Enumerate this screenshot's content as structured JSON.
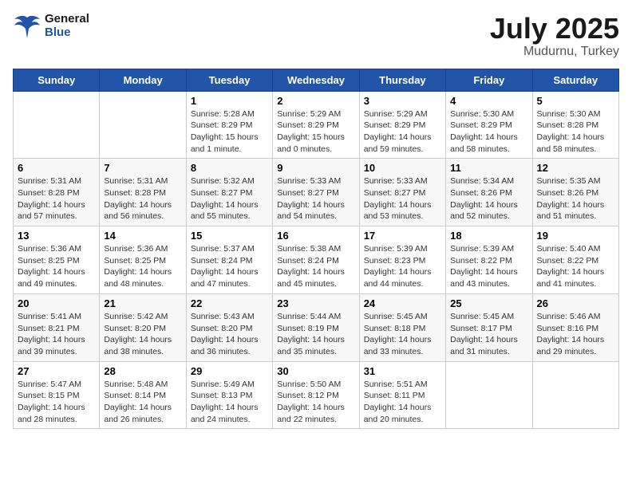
{
  "header": {
    "logo_general": "General",
    "logo_blue": "Blue",
    "title": "July 2025",
    "location": "Mudurnu, Turkey"
  },
  "weekdays": [
    "Sunday",
    "Monday",
    "Tuesday",
    "Wednesday",
    "Thursday",
    "Friday",
    "Saturday"
  ],
  "weeks": [
    [
      {
        "day": "",
        "detail": ""
      },
      {
        "day": "",
        "detail": ""
      },
      {
        "day": "1",
        "detail": "Sunrise: 5:28 AM\nSunset: 8:29 PM\nDaylight: 15 hours and 1 minute."
      },
      {
        "day": "2",
        "detail": "Sunrise: 5:29 AM\nSunset: 8:29 PM\nDaylight: 15 hours and 0 minutes."
      },
      {
        "day": "3",
        "detail": "Sunrise: 5:29 AM\nSunset: 8:29 PM\nDaylight: 14 hours and 59 minutes."
      },
      {
        "day": "4",
        "detail": "Sunrise: 5:30 AM\nSunset: 8:29 PM\nDaylight: 14 hours and 58 minutes."
      },
      {
        "day": "5",
        "detail": "Sunrise: 5:30 AM\nSunset: 8:28 PM\nDaylight: 14 hours and 58 minutes."
      }
    ],
    [
      {
        "day": "6",
        "detail": "Sunrise: 5:31 AM\nSunset: 8:28 PM\nDaylight: 14 hours and 57 minutes."
      },
      {
        "day": "7",
        "detail": "Sunrise: 5:31 AM\nSunset: 8:28 PM\nDaylight: 14 hours and 56 minutes."
      },
      {
        "day": "8",
        "detail": "Sunrise: 5:32 AM\nSunset: 8:27 PM\nDaylight: 14 hours and 55 minutes."
      },
      {
        "day": "9",
        "detail": "Sunrise: 5:33 AM\nSunset: 8:27 PM\nDaylight: 14 hours and 54 minutes."
      },
      {
        "day": "10",
        "detail": "Sunrise: 5:33 AM\nSunset: 8:27 PM\nDaylight: 14 hours and 53 minutes."
      },
      {
        "day": "11",
        "detail": "Sunrise: 5:34 AM\nSunset: 8:26 PM\nDaylight: 14 hours and 52 minutes."
      },
      {
        "day": "12",
        "detail": "Sunrise: 5:35 AM\nSunset: 8:26 PM\nDaylight: 14 hours and 51 minutes."
      }
    ],
    [
      {
        "day": "13",
        "detail": "Sunrise: 5:36 AM\nSunset: 8:25 PM\nDaylight: 14 hours and 49 minutes."
      },
      {
        "day": "14",
        "detail": "Sunrise: 5:36 AM\nSunset: 8:25 PM\nDaylight: 14 hours and 48 minutes."
      },
      {
        "day": "15",
        "detail": "Sunrise: 5:37 AM\nSunset: 8:24 PM\nDaylight: 14 hours and 47 minutes."
      },
      {
        "day": "16",
        "detail": "Sunrise: 5:38 AM\nSunset: 8:24 PM\nDaylight: 14 hours and 45 minutes."
      },
      {
        "day": "17",
        "detail": "Sunrise: 5:39 AM\nSunset: 8:23 PM\nDaylight: 14 hours and 44 minutes."
      },
      {
        "day": "18",
        "detail": "Sunrise: 5:39 AM\nSunset: 8:22 PM\nDaylight: 14 hours and 43 minutes."
      },
      {
        "day": "19",
        "detail": "Sunrise: 5:40 AM\nSunset: 8:22 PM\nDaylight: 14 hours and 41 minutes."
      }
    ],
    [
      {
        "day": "20",
        "detail": "Sunrise: 5:41 AM\nSunset: 8:21 PM\nDaylight: 14 hours and 39 minutes."
      },
      {
        "day": "21",
        "detail": "Sunrise: 5:42 AM\nSunset: 8:20 PM\nDaylight: 14 hours and 38 minutes."
      },
      {
        "day": "22",
        "detail": "Sunrise: 5:43 AM\nSunset: 8:20 PM\nDaylight: 14 hours and 36 minutes."
      },
      {
        "day": "23",
        "detail": "Sunrise: 5:44 AM\nSunset: 8:19 PM\nDaylight: 14 hours and 35 minutes."
      },
      {
        "day": "24",
        "detail": "Sunrise: 5:45 AM\nSunset: 8:18 PM\nDaylight: 14 hours and 33 minutes."
      },
      {
        "day": "25",
        "detail": "Sunrise: 5:45 AM\nSunset: 8:17 PM\nDaylight: 14 hours and 31 minutes."
      },
      {
        "day": "26",
        "detail": "Sunrise: 5:46 AM\nSunset: 8:16 PM\nDaylight: 14 hours and 29 minutes."
      }
    ],
    [
      {
        "day": "27",
        "detail": "Sunrise: 5:47 AM\nSunset: 8:15 PM\nDaylight: 14 hours and 28 minutes."
      },
      {
        "day": "28",
        "detail": "Sunrise: 5:48 AM\nSunset: 8:14 PM\nDaylight: 14 hours and 26 minutes."
      },
      {
        "day": "29",
        "detail": "Sunrise: 5:49 AM\nSunset: 8:13 PM\nDaylight: 14 hours and 24 minutes."
      },
      {
        "day": "30",
        "detail": "Sunrise: 5:50 AM\nSunset: 8:12 PM\nDaylight: 14 hours and 22 minutes."
      },
      {
        "day": "31",
        "detail": "Sunrise: 5:51 AM\nSunset: 8:11 PM\nDaylight: 14 hours and 20 minutes."
      },
      {
        "day": "",
        "detail": ""
      },
      {
        "day": "",
        "detail": ""
      }
    ]
  ]
}
